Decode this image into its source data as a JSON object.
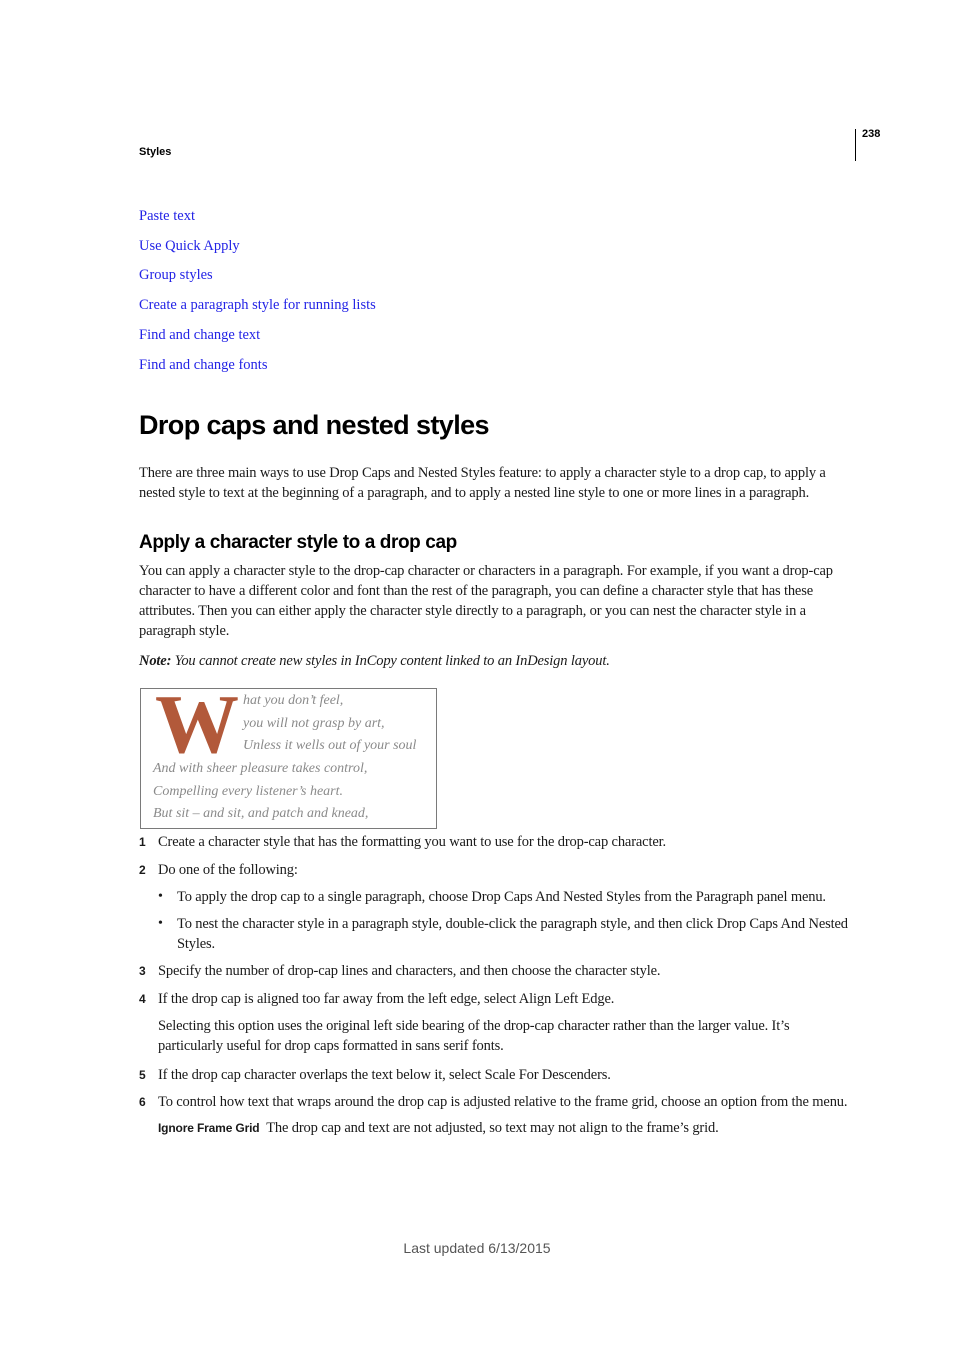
{
  "header": {
    "section": "Styles",
    "page_number": "238"
  },
  "related_links": [
    "Paste text",
    "Use Quick Apply",
    "Group styles",
    "Create a paragraph style for running lists",
    "Find and change text",
    "Find and change fonts"
  ],
  "main": {
    "title": "Drop caps and nested styles",
    "intro": "There are three main ways to use Drop Caps and Nested Styles feature: to apply a character style to a drop cap, to apply a nested style to text at the beginning of a paragraph, and to apply a nested line style to one or more lines in a paragraph.",
    "section": {
      "heading": "Apply a character style to a drop cap",
      "body": "You can apply a character style to the drop-cap character or characters in a paragraph. For example, if you want a drop-cap character to have a different color and font than the rest of the paragraph, you can define a character style that has these attributes. Then you can either apply the character style directly to a paragraph, or you can nest the character style in a paragraph style.",
      "note_label": "Note:",
      "note_text": " You cannot create new styles in InCopy content linked to an InDesign layout.",
      "figure": {
        "drop_cap": "W",
        "drop_cap_color": "#b2593a",
        "indented_lines": [
          "hat you don’t feel,",
          "you will not grasp by art,",
          "Unless it wells out of your soul"
        ],
        "full_lines": [
          "And with sheer pleasure takes control,",
          "Compelling every listener’s heart.",
          "But sit – and sit, and patch and knead,"
        ]
      },
      "steps": [
        {
          "num": "1",
          "text": "Create a character style that has the formatting you want to use for the drop-cap character."
        },
        {
          "num": "2",
          "text": "Do one of the following:"
        },
        {
          "num": "3",
          "text": "Specify the number of drop-cap lines and characters, and then choose the character style."
        },
        {
          "num": "4",
          "text": "If the drop cap is aligned too far away from the left edge, select Align Left Edge."
        },
        {
          "num": "5",
          "text": "If the drop cap character overlaps the text below it, select Scale For Descenders."
        },
        {
          "num": "6",
          "text": "To control how text that wraps around the drop cap is adjusted relative to the frame grid, choose an option from the menu."
        }
      ],
      "step2_bullets": [
        "To apply the drop cap to a single paragraph, choose Drop Caps And Nested Styles from the Paragraph panel menu.",
        "To nest the character style in a paragraph style, double-click the paragraph style, and then click Drop Caps And Nested Styles."
      ],
      "bullet_glyph": "•",
      "step4_detail": "Selecting this option uses the original left side bearing of the drop-cap character rather than the larger value. It’s particularly useful for drop caps formatted in sans serif fonts.",
      "step6_option": {
        "term": "Ignore Frame Grid",
        "desc": "The drop cap and text are not adjusted, so text may not align to the frame’s grid."
      }
    }
  },
  "footer": {
    "last_updated": "Last updated 6/13/2015"
  }
}
